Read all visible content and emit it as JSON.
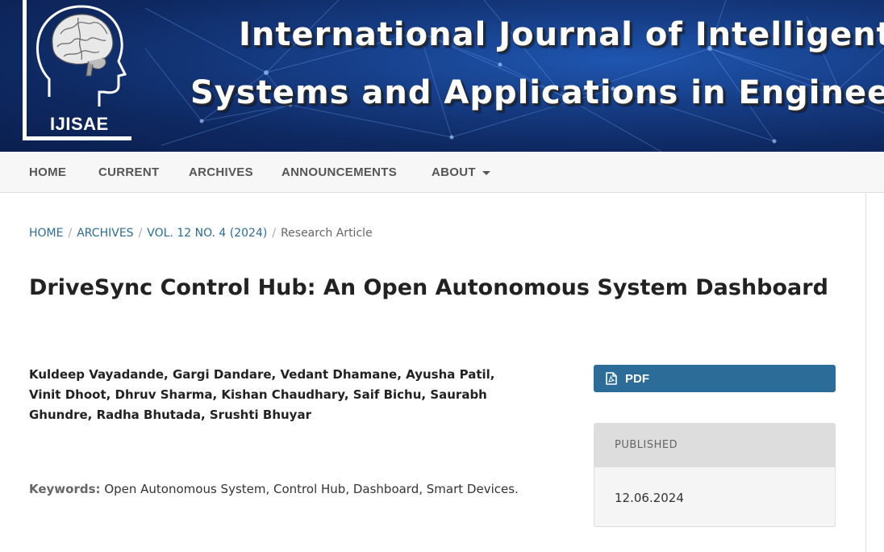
{
  "header": {
    "logo_text": "IJISAE",
    "journal_title_line1": "International Journal of Intelligent",
    "journal_title_line2": "Systems and Applications in Engineering"
  },
  "nav": {
    "items": [
      {
        "label": "HOME"
      },
      {
        "label": "CURRENT"
      },
      {
        "label": "ARCHIVES"
      },
      {
        "label": "ANNOUNCEMENTS"
      },
      {
        "label": "ABOUT"
      }
    ]
  },
  "breadcrumb": {
    "items": [
      {
        "label": "HOME"
      },
      {
        "label": "ARCHIVES"
      },
      {
        "label": "VOL. 12 NO. 4 (2024)"
      }
    ],
    "current": "Research Article",
    "separator": "/"
  },
  "article": {
    "title": "DriveSync Control Hub: An Open Autonomous System Dashboard",
    "authors": "Kuldeep Vayadande, Gargi Dandare, Vedant Dhamane, Ayusha Patil, Vinit Dhoot, Dhruv Sharma, Kishan Chaudhary, Saif Bichu, Saurabh Ghundre, Radha Bhutada, Srushti Bhuyar",
    "keywords_label": "Keywords:",
    "keywords": "Open Autonomous System, Control Hub, Dashboard, Smart Devices."
  },
  "sidebar": {
    "pdf_label": "PDF",
    "published_label": "PUBLISHED",
    "published_date": "12.06.2024"
  },
  "colors": {
    "banner_dark": "#0e2860",
    "banner_light": "#1f56b0",
    "link": "#2b6c99",
    "pdf_button": "#2b6c99",
    "nav_bg": "#f7f7f7",
    "nav_text": "#555555"
  },
  "icons": {
    "logo": "brain-head-icon",
    "about_dropdown": "caret-down-icon",
    "pdf": "file-pdf-icon"
  }
}
